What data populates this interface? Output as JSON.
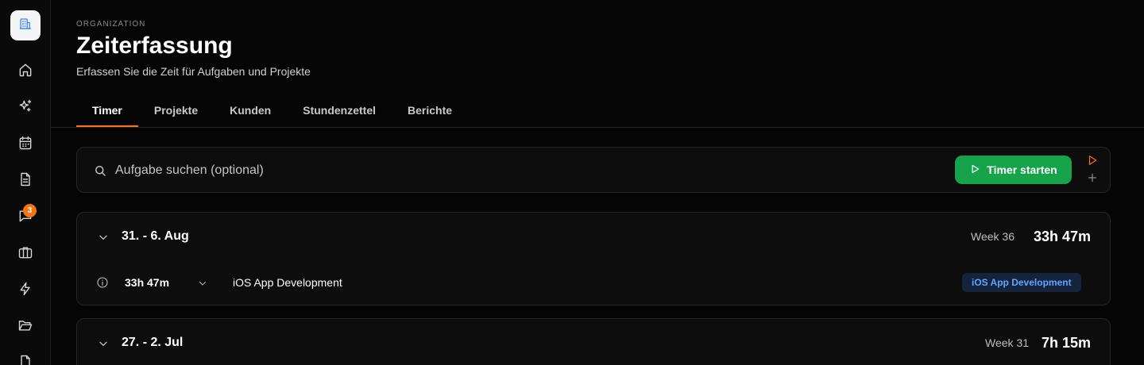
{
  "sidebar": {
    "logo_icon": "building-icon",
    "notification_count": "3",
    "items": [
      {
        "name": "home",
        "icon": "home-icon"
      },
      {
        "name": "ai",
        "icon": "sparkles-icon"
      },
      {
        "name": "calendar",
        "icon": "calendar-icon"
      },
      {
        "name": "documents",
        "icon": "document-icon"
      },
      {
        "name": "messages",
        "icon": "chat-icon"
      },
      {
        "name": "projects",
        "icon": "briefcase-icon"
      },
      {
        "name": "automations",
        "icon": "lightning-icon"
      },
      {
        "name": "files",
        "icon": "folder-open-icon"
      },
      {
        "name": "file",
        "icon": "file-icon"
      }
    ]
  },
  "header": {
    "eyebrow": "ORGANIZATION",
    "title": "Zeiterfassung",
    "subtitle": "Erfassen Sie die Zeit für Aufgaben und Projekte"
  },
  "tabs": [
    {
      "label": "Timer",
      "active": true
    },
    {
      "label": "Projekte",
      "active": false
    },
    {
      "label": "Kunden",
      "active": false
    },
    {
      "label": "Stundenzettel",
      "active": false
    },
    {
      "label": "Berichte",
      "active": false
    }
  ],
  "timer_bar": {
    "placeholder": "Aufgabe suchen (optional)",
    "value": "",
    "start_label": "Timer starten"
  },
  "weeks": [
    {
      "range": "31. - 6. Aug",
      "week_label": "Week 36",
      "total": "33h 47m",
      "entries": [
        {
          "duration": "33h 47m",
          "task": "iOS App Development",
          "project": "iOS App Development"
        }
      ]
    },
    {
      "range": "27. - 2. Jul",
      "week_label": "Week 31",
      "total": "7h 15m",
      "entries": []
    }
  ],
  "colors": {
    "accent": "#f97316",
    "primary_button": "#16a34a",
    "tag_text": "#60a5fa",
    "tag_bg": "#15233d"
  }
}
